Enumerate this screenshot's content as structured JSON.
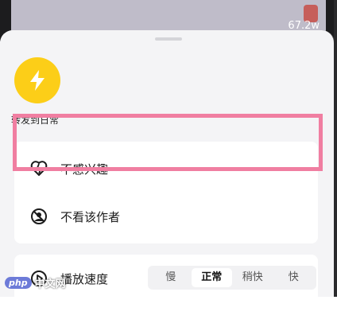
{
  "video": {
    "view_count": "67.2w"
  },
  "share": {
    "label": "转发到日常",
    "color": "#fcce18"
  },
  "menu": {
    "items": [
      {
        "label": "不感兴趣",
        "icon": "broken-heart-icon"
      },
      {
        "label": "不看该作者",
        "icon": "block-user-icon"
      }
    ],
    "highlight_color": "#f07ea1"
  },
  "playback": {
    "label": "播放速度",
    "icon": "play-circle-icon",
    "options": [
      "慢",
      "正常",
      "稍快",
      "快"
    ],
    "selected": "正常"
  },
  "watermark": {
    "badge": "php",
    "text": "中文网"
  }
}
